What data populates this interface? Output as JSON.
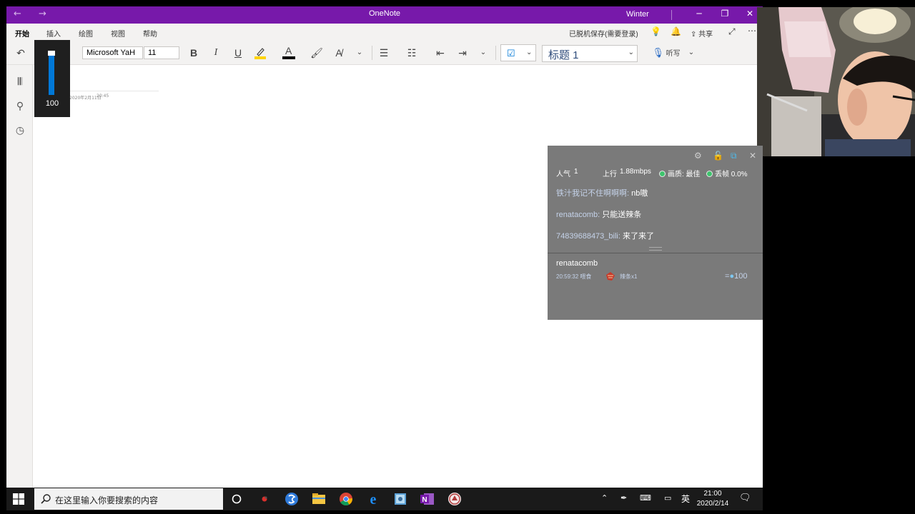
{
  "titlebar": {
    "back": "←",
    "forward": "→",
    "title": "OneNote",
    "user": "Winter",
    "minimize": "─",
    "restore": "❐",
    "close": "✕"
  },
  "menubar": {
    "tabs": [
      "开始",
      "插入",
      "绘图",
      "视图",
      "帮助"
    ],
    "save_status": "已脱机保存(需要登录)",
    "share": "共享"
  },
  "ribbon": {
    "font_name": "Microsoft YaH",
    "font_size": "11",
    "bold": "B",
    "italic": "I",
    "underline": "U",
    "font_color": "A",
    "style": "标题 1",
    "dictate": "听写",
    "highlight_color": "#ffd400",
    "font_color_value": "#000000"
  },
  "page": {
    "date": "2020年2月11日",
    "time": "20:45"
  },
  "volume": {
    "level": 100,
    "label": "100"
  },
  "overlay": {
    "popularity_label": "人气",
    "popularity_value": "1",
    "upload_label": "上行",
    "upload_value": "1.88mbps",
    "quality": "画质: 最佳",
    "drop": "丢帧 0.0%",
    "messages": [
      {
        "user": "铁汁我记不住啊啊啊:",
        "text": "nb嗷"
      },
      {
        "user": "renatacomb:",
        "text": "只能送辣条"
      },
      {
        "user": "74839688473_bili:",
        "text": "来了来了"
      }
    ],
    "gift": {
      "user": "renatacomb",
      "meta": "20:59:32 喂食",
      "item": "辣条x1",
      "value": "100"
    }
  },
  "taskbar": {
    "search_placeholder": "在这里输入你要搜索的内容",
    "ime": "英",
    "time": "21:00",
    "date": "2020/2/14"
  }
}
